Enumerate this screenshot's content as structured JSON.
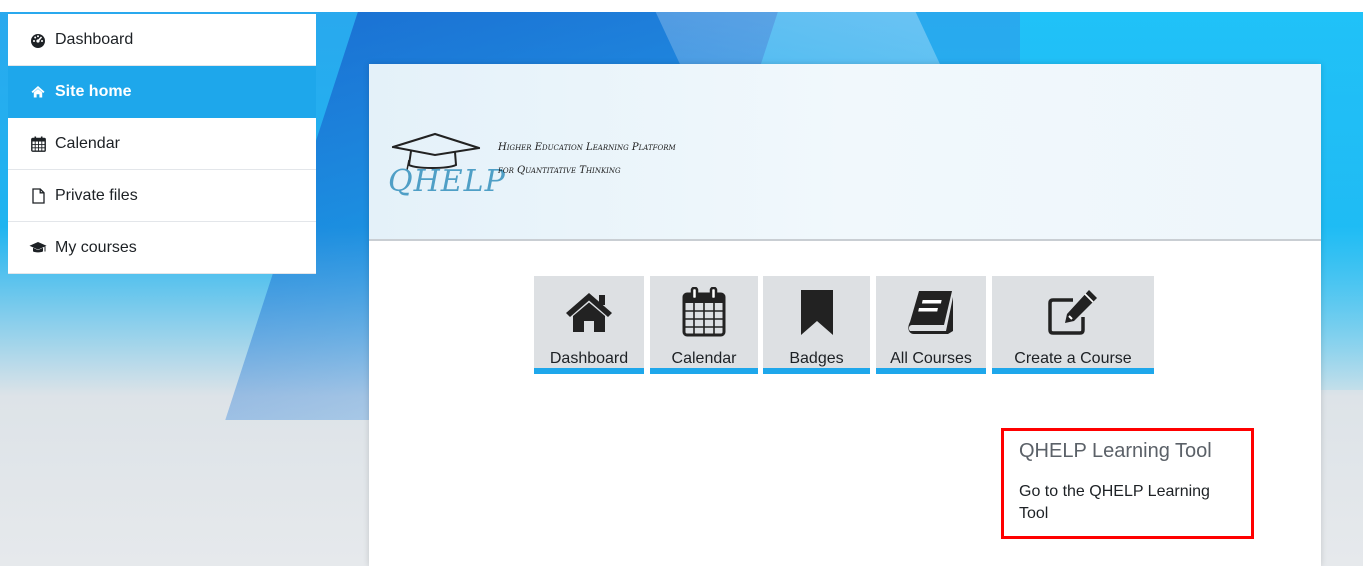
{
  "sidebar": {
    "items": [
      {
        "label": "Dashboard",
        "icon": "dashboard-icon"
      },
      {
        "label": "Site home",
        "icon": "home-icon",
        "active": true
      },
      {
        "label": "Calendar",
        "icon": "calendar-icon"
      },
      {
        "label": "Private files",
        "icon": "file-icon"
      },
      {
        "label": "My courses",
        "icon": "graduation-cap-icon"
      }
    ]
  },
  "banner": {
    "logo_text": "QHELP",
    "tagline_line1": "Higher Education Learning Platform",
    "tagline_line2": "for Quantitative Thinking"
  },
  "tiles": [
    {
      "label": "Dashboard",
      "icon": "home-icon"
    },
    {
      "label": "Calendar",
      "icon": "calendar-icon"
    },
    {
      "label": "Badges",
      "icon": "bookmark-icon"
    },
    {
      "label": "All Courses",
      "icon": "book-icon"
    },
    {
      "label": "Create a Course",
      "icon": "edit-icon"
    }
  ],
  "learning_tool": {
    "title": "QHELP Learning Tool",
    "link": "Go to the QHELP Learning Tool"
  },
  "colors": {
    "accent": "#1ea7eb",
    "highlight_border": "#ff0000",
    "tile_bg": "#dde0e3"
  }
}
